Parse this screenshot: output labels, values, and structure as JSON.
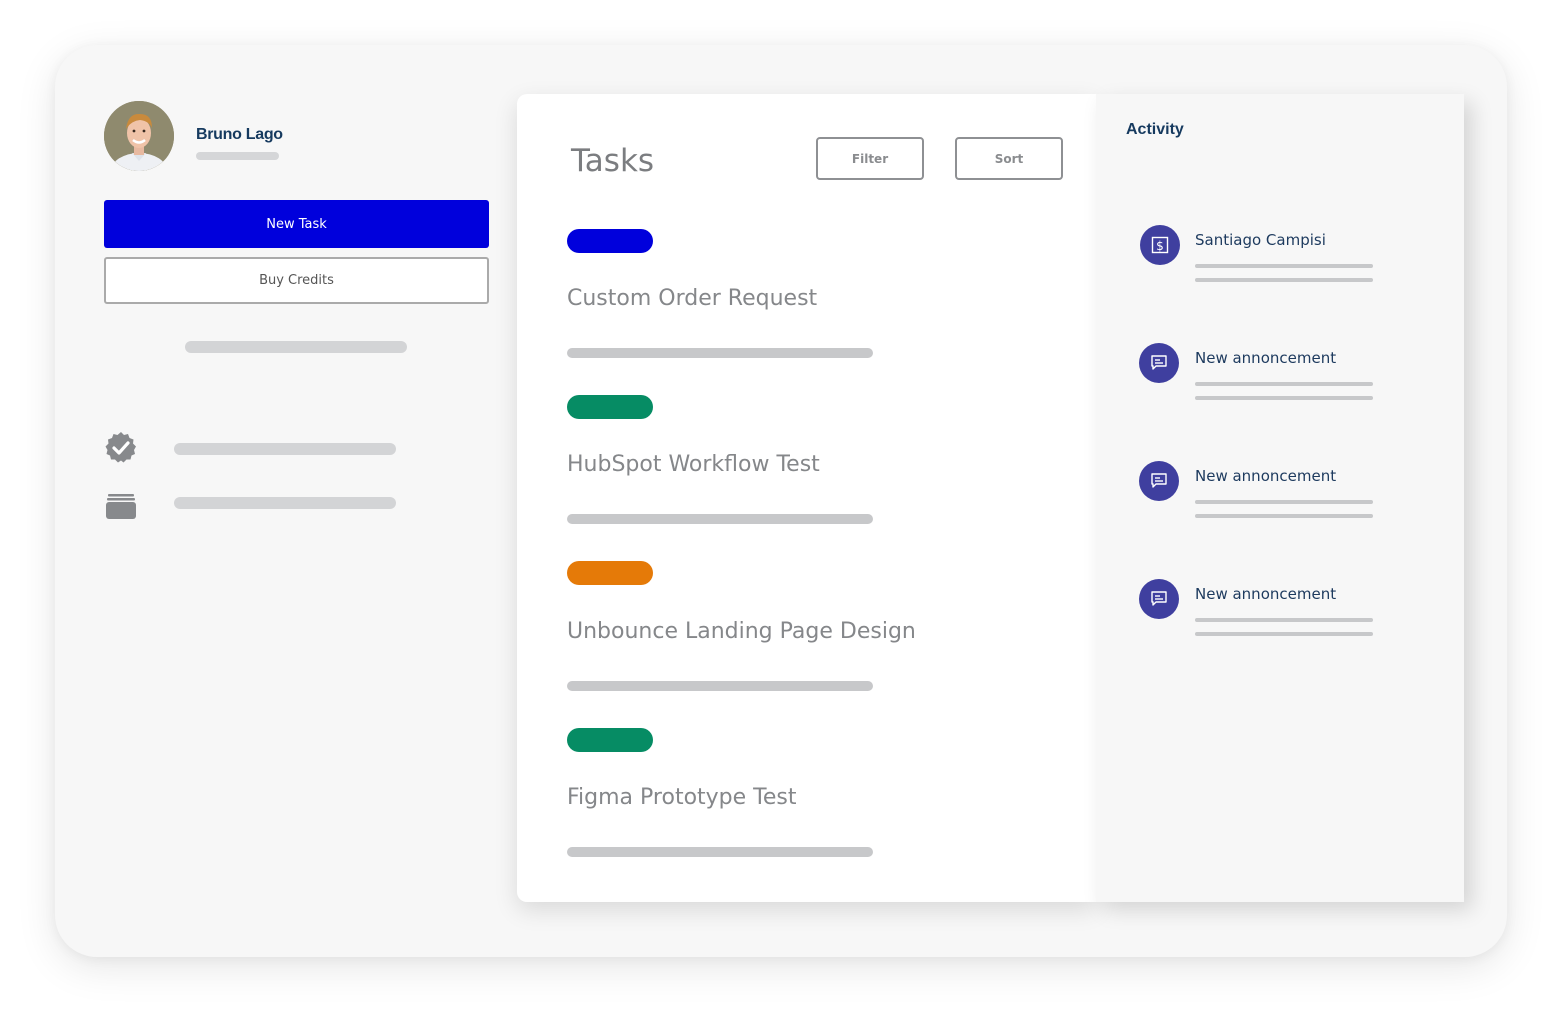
{
  "user": {
    "name": "Bruno Lago",
    "avatar_icon": "user-photo"
  },
  "sidebar": {
    "new_task_label": "New Task",
    "buy_credits_label": "Buy Credits",
    "items": [
      {
        "icon": "verified-badge-icon"
      },
      {
        "icon": "stack-cards-icon"
      }
    ]
  },
  "tasks": {
    "title": "Tasks",
    "filter_label": "Filter",
    "sort_label": "Sort",
    "items": [
      {
        "title": "Custom Order Request",
        "status_color": "#0000dc"
      },
      {
        "title": "HubSpot Workflow Test",
        "status_color": "#068c64"
      },
      {
        "title": "Unbounce Landing Page Design",
        "status_color": "#e57a08"
      },
      {
        "title": "Figma Prototype Test",
        "status_color": "#068c64"
      }
    ]
  },
  "activity": {
    "title": "Activity",
    "items": [
      {
        "icon": "dollar-icon",
        "label": "Santiago Campisi"
      },
      {
        "icon": "chat-icon",
        "label": "New annoncement"
      },
      {
        "icon": "chat-icon",
        "label": "New annoncement"
      },
      {
        "icon": "chat-icon",
        "label": "New annoncement"
      }
    ]
  },
  "colors": {
    "primary": "#0000dc",
    "activity_icon_bg": "#3f3f9f",
    "heading": "#163a5f"
  }
}
